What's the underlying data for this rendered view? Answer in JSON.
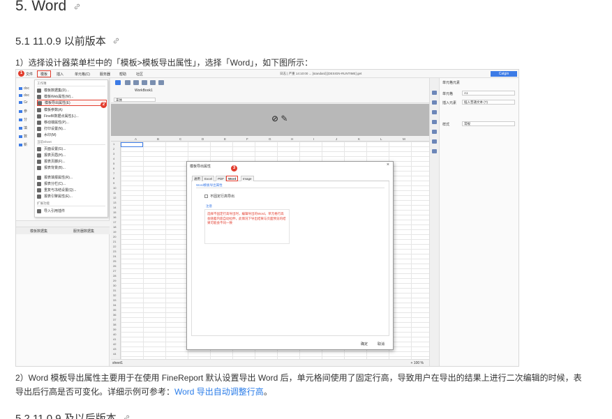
{
  "heading": {
    "title": "5. Word"
  },
  "section": {
    "title": "5.1 11.0.9 以前版本"
  },
  "intro": "1）选择设计器菜单栏中的「模板>模板导出属性」，选择「Word」，如下图所示：",
  "screenshot": {
    "menubar": {
      "items": [
        "文件",
        "模板",
        "插入",
        "单元格(C)",
        "服务器",
        "帮助",
        "社区"
      ],
      "badge1": "1",
      "log": "日志 | 严重 14:10:00 ... [standard] [DESIGN-RUNTIME] get",
      "user": "Catgin"
    },
    "menu": {
      "group1": "工作簿",
      "items1": [
        "模板数据集(D)...",
        "模板Web属性(W)...",
        "模板导出属性(E)",
        "模板参数(A)",
        "FineBI数据点属性(L)...",
        "移动端属性(P)...",
        "打印设置(N)...",
        "水印(M)"
      ],
      "group2": "当前Sheet",
      "items2": [
        "页面设置(G)...",
        "报表页眉(H)...",
        "报表页脚(F)...",
        "报表背景(B)...",
        "报表填报属性(R)...",
        "报表分栏(C)...",
        "重复与冻结设置(Q)...",
        "报表引擎属性(E)..."
      ],
      "group3": "扩展功能",
      "items3": [
        "导入引用插件"
      ],
      "badge2": "2"
    },
    "left_tabs": [
      "模板数据集",
      "服务器数据集"
    ],
    "tab_file": "WorkBook1",
    "font": "宋体",
    "columns": [
      "A",
      "B",
      "C",
      "D",
      "E",
      "F",
      "G",
      "H",
      "I",
      "J",
      "K",
      "L",
      "M"
    ],
    "sheet": "sheet1",
    "zoom": "+ 100 %",
    "right": {
      "title": "单元格元素",
      "rows": [
        {
          "label": "单元格",
          "value": "A1"
        },
        {
          "label": "插入元素",
          "value": "插入普通文本 (T)"
        },
        {
          "label": "样式",
          "value": "常规"
        }
      ]
    },
    "dialog": {
      "title": "模板导出属性",
      "close": "×",
      "tabs": [
        "通用",
        "Excel",
        "PDF",
        "Word",
        "Image"
      ],
      "badge3": "3",
      "section": "Word模板导出属性",
      "checkbox": "不固定行高导出",
      "note_title": "注意",
      "note": "选择不固定行高导出时，编辑导出的Word，单元格行高会随着内容自动拉伸，此情况下导出结果与页面预览的结果可能会不同一致",
      "ok": "确定",
      "cancel": "取消"
    }
  },
  "para2": {
    "line1": "2）Word 模板导出属性主要用于在使用 FineReport 默认设置导出 Word 后，单元格间使用了固定行高，导致用户在导出的结果上进行二次编辑的时候，表",
    "line2_pre": "导出后行高是否可变化。详细示例可参考：",
    "link": "Word 导出自动调整行高",
    "line2_post": "。"
  },
  "section2": {
    "title": "5.2 11.0.9 及以后版本"
  }
}
